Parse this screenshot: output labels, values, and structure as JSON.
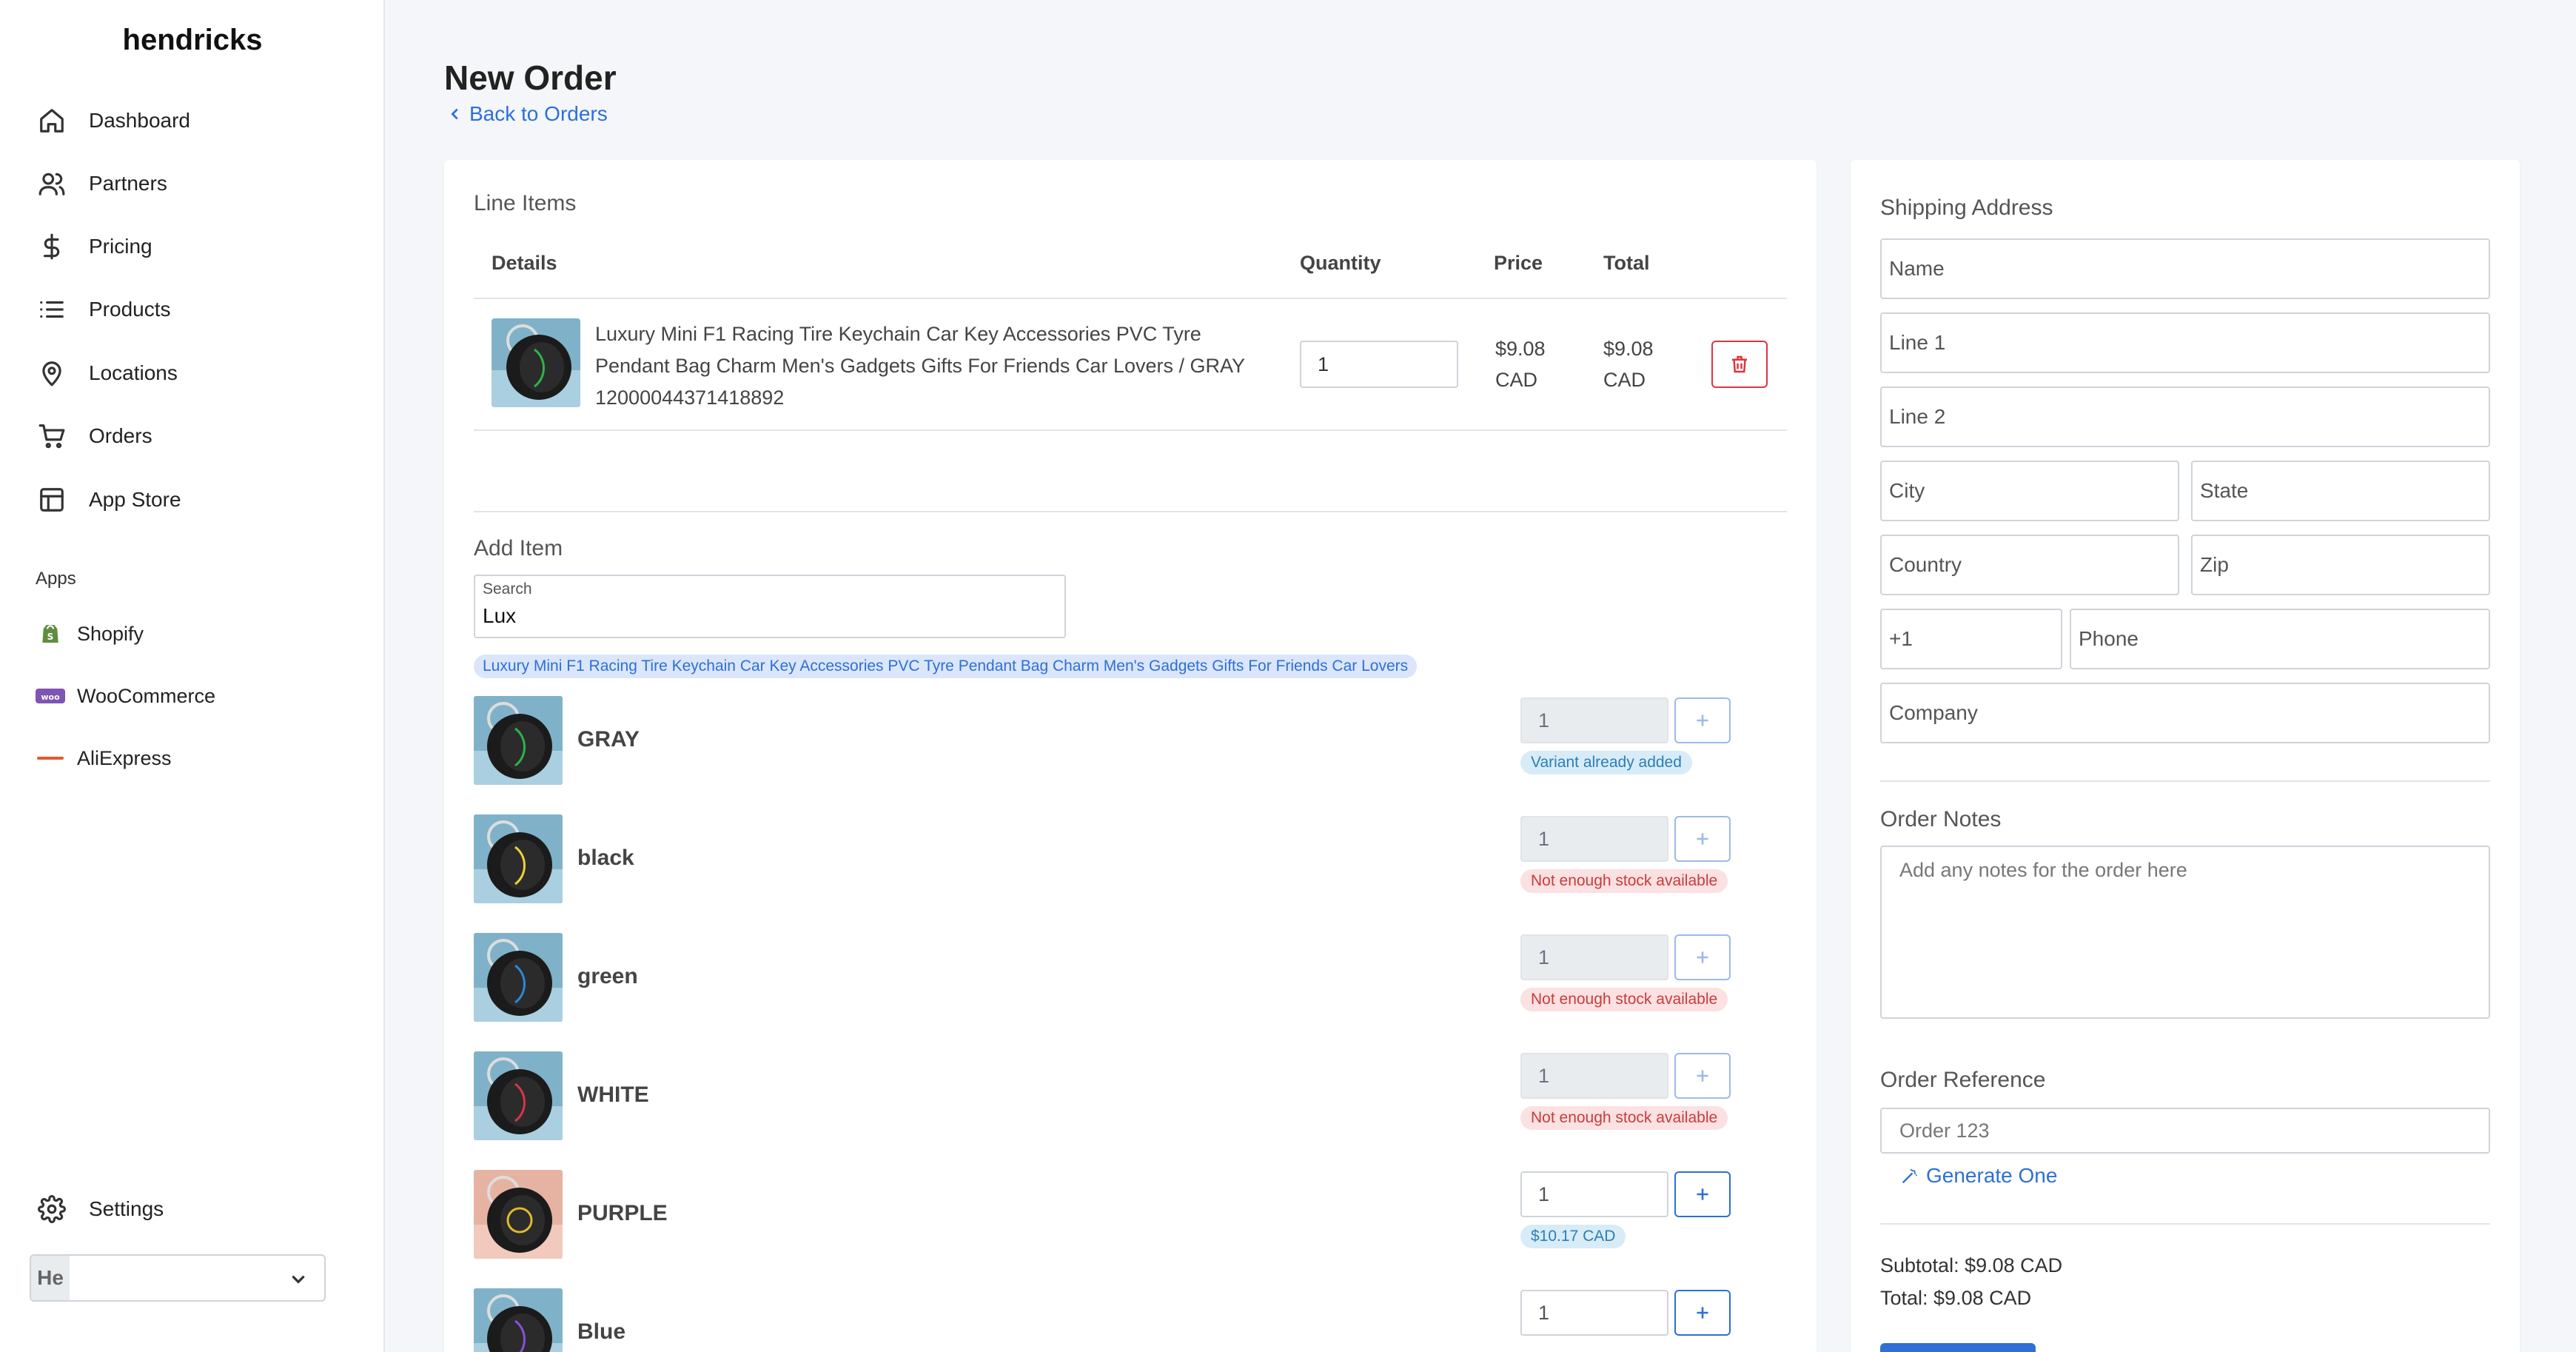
{
  "brand": "hendricks",
  "nav": [
    {
      "label": "Dashboard",
      "icon": "home-icon"
    },
    {
      "label": "Partners",
      "icon": "users-icon"
    },
    {
      "label": "Pricing",
      "icon": "dollar-icon"
    },
    {
      "label": "Products",
      "icon": "list-icon"
    },
    {
      "label": "Locations",
      "icon": "map-pin-icon"
    },
    {
      "label": "Orders",
      "icon": "cart-icon"
    },
    {
      "label": "App Store",
      "icon": "layout-icon"
    }
  ],
  "apps_heading": "Apps",
  "apps": [
    {
      "label": "Shopify",
      "icon": "shopify-icon"
    },
    {
      "label": "WooCommerce",
      "icon": "woocommerce-icon"
    },
    {
      "label": "AliExpress",
      "icon": "aliexpress-icon"
    }
  ],
  "settings_label": "Settings",
  "account": {
    "initials": "He"
  },
  "page": {
    "title": "New Order",
    "back_link": "Back to Orders"
  },
  "line_items": {
    "title": "Line Items",
    "headers": {
      "details": "Details",
      "quantity": "Quantity",
      "price": "Price",
      "total": "Total"
    },
    "rows": [
      {
        "description_line1": "Luxury Mini F1 Racing Tire Keychain Car Key Accessories PVC Tyre",
        "description_line2": "Pendant Bag Charm Men's Gadgets Gifts For Friends Car Lovers / GRAY",
        "sku": "12000044371418892",
        "quantity": "1",
        "price_amount": "$9.08",
        "price_currency": "CAD",
        "total_amount": "$9.08",
        "total_currency": "CAD"
      }
    ]
  },
  "add_item": {
    "title": "Add Item",
    "search_label": "Search",
    "search_value": "Lux",
    "product_title": "Luxury Mini F1 Racing Tire Keychain Car Key Accessories PVC Tyre Pendant Bag Charm Men's Gadgets Gifts For Friends Car Lovers",
    "variants": [
      {
        "name": "GRAY",
        "qty": "1",
        "badge": "Variant already added",
        "badge_type": "info",
        "disabled": true,
        "accent": "#2db34a"
      },
      {
        "name": "black",
        "qty": "1",
        "badge": "Not enough stock available",
        "badge_type": "danger",
        "disabled": true,
        "accent": "#e8d23a"
      },
      {
        "name": "green",
        "qty": "1",
        "badge": "Not enough stock available",
        "badge_type": "danger",
        "disabled": true,
        "accent": "#2f86d6"
      },
      {
        "name": "WHITE",
        "qty": "1",
        "badge": "Not enough stock available",
        "badge_type": "danger",
        "disabled": true,
        "accent": "#d8344a"
      },
      {
        "name": "PURPLE",
        "qty": "1",
        "badge": "$10.17 CAD",
        "badge_type": "info",
        "disabled": false,
        "accent": "#e0b92c"
      },
      {
        "name": "Blue",
        "qty": "1",
        "badge": "",
        "badge_type": "info",
        "disabled": false,
        "accent": "#8a4fd6"
      }
    ]
  },
  "shipping": {
    "title": "Shipping Address",
    "name": "Name",
    "line1": "Line 1",
    "line2": "Line 2",
    "city": "City",
    "state": "State",
    "country": "Country",
    "zip": "Zip",
    "dial_code": "+1",
    "phone": "Phone",
    "company": "Company"
  },
  "notes": {
    "title": "Order Notes",
    "placeholder": "Add any notes for the order here"
  },
  "reference": {
    "title": "Order Reference",
    "placeholder": "Order 123",
    "generate_label": "Generate One"
  },
  "summary": {
    "subtotal": "Subtotal: $9.08 CAD",
    "total": "Total: $9.08 CAD"
  },
  "colors": {
    "accent": "#2e6fd8",
    "danger": "#d9363e",
    "background": "#f4f6f9"
  }
}
